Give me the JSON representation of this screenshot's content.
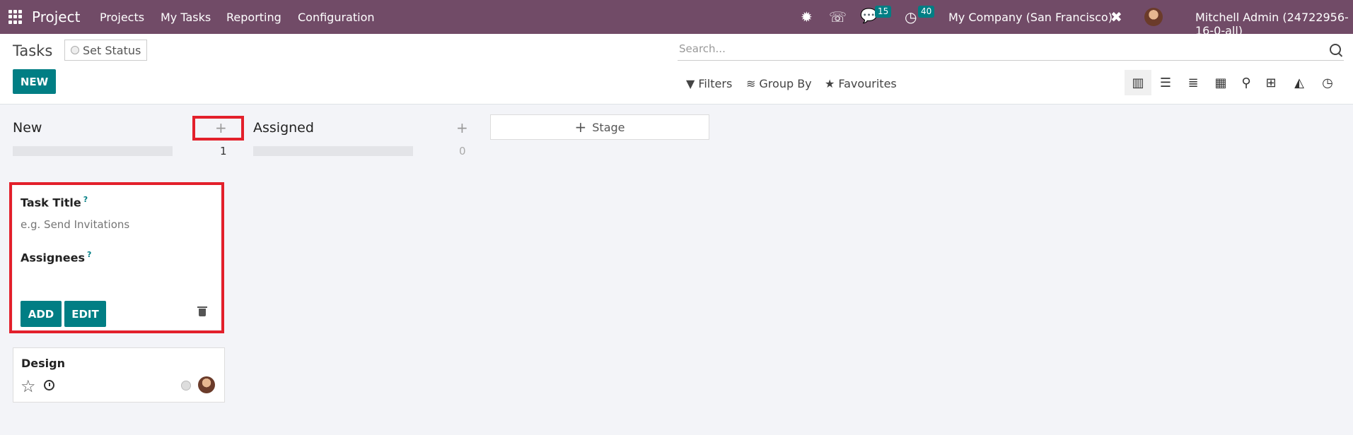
{
  "topbar": {
    "brand": "Project",
    "menu": [
      "Projects",
      "My Tasks",
      "Reporting",
      "Configuration"
    ],
    "messages_count": "15",
    "activities_count": "40",
    "company": "My Company (San Francisco)",
    "user": "Mitchell Admin (24722956-16-0-all)",
    "color": "#714b67"
  },
  "control": {
    "title": "Tasks",
    "set_status": "Set Status",
    "new_button": "NEW",
    "search_placeholder": "Search...",
    "filters": "Filters",
    "group_by": "Group By",
    "favourites": "Favourites",
    "views": [
      "kanban",
      "list",
      "gantt",
      "calendar",
      "map",
      "pivot",
      "graph",
      "activity"
    ],
    "active_view": "kanban"
  },
  "columns": [
    {
      "name": "New",
      "count": "1"
    },
    {
      "name": "Assigned",
      "count": "0"
    }
  ],
  "add_stage": "Stage",
  "quick_create": {
    "task_title_label": "Task Title",
    "task_title_placeholder": "e.g. Send Invitations",
    "help_mark": "?",
    "assignees_label": "Assignees",
    "add_button": "ADD",
    "edit_button": "EDIT"
  },
  "cards": [
    {
      "title": "Design"
    }
  ],
  "colors": {
    "accent": "#017e84",
    "highlight": "#e3202b"
  }
}
